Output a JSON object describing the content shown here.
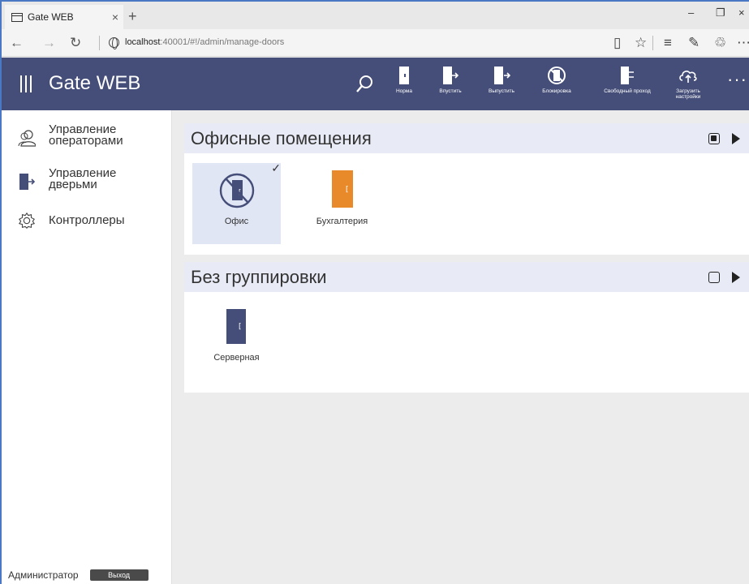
{
  "browser": {
    "tab_title": "Gate WEB",
    "tab_close": "×",
    "new_tab": "+",
    "url_host": "localhost",
    "url_path": ":40001/#!/admin/manage-doors",
    "win_minimize": "–",
    "win_restore": "❐",
    "win_close": "×"
  },
  "app": {
    "title": "Gate WEB",
    "more": "···",
    "toolbar": [
      {
        "id": "norm",
        "label": "Норма"
      },
      {
        "id": "let-in",
        "label": "Впустить"
      },
      {
        "id": "let-out",
        "label": "Выпустить"
      },
      {
        "id": "lock",
        "label": "Блокировка"
      },
      {
        "id": "free-pass",
        "label": "Свободный проход"
      },
      {
        "id": "upload",
        "label": "Загрузить настройки"
      }
    ]
  },
  "sidebar": {
    "items": [
      {
        "id": "operators",
        "label": "Управление операторами"
      },
      {
        "id": "doors",
        "label": "Управление дверьми"
      },
      {
        "id": "controllers",
        "label": "Контроллеры"
      }
    ],
    "user": "Администратор",
    "logout": "Выход"
  },
  "groups": [
    {
      "title": "Офисные помещения",
      "selected_all": true,
      "doors": [
        {
          "name": "Офис",
          "state": "blocked",
          "selected": true,
          "color": "#454e78"
        },
        {
          "name": "Бухгалтерия",
          "state": "normal",
          "selected": false,
          "color": "#e8892a"
        }
      ]
    },
    {
      "title": "Без группировки",
      "selected_all": false,
      "doors": [
        {
          "name": "Серверная",
          "state": "normal",
          "selected": false,
          "color": "#454e78"
        }
      ]
    }
  ],
  "colors": {
    "header": "#454e78",
    "group_header": "#e8ebf6",
    "door_blue": "#454e78",
    "door_orange": "#e8892a"
  }
}
